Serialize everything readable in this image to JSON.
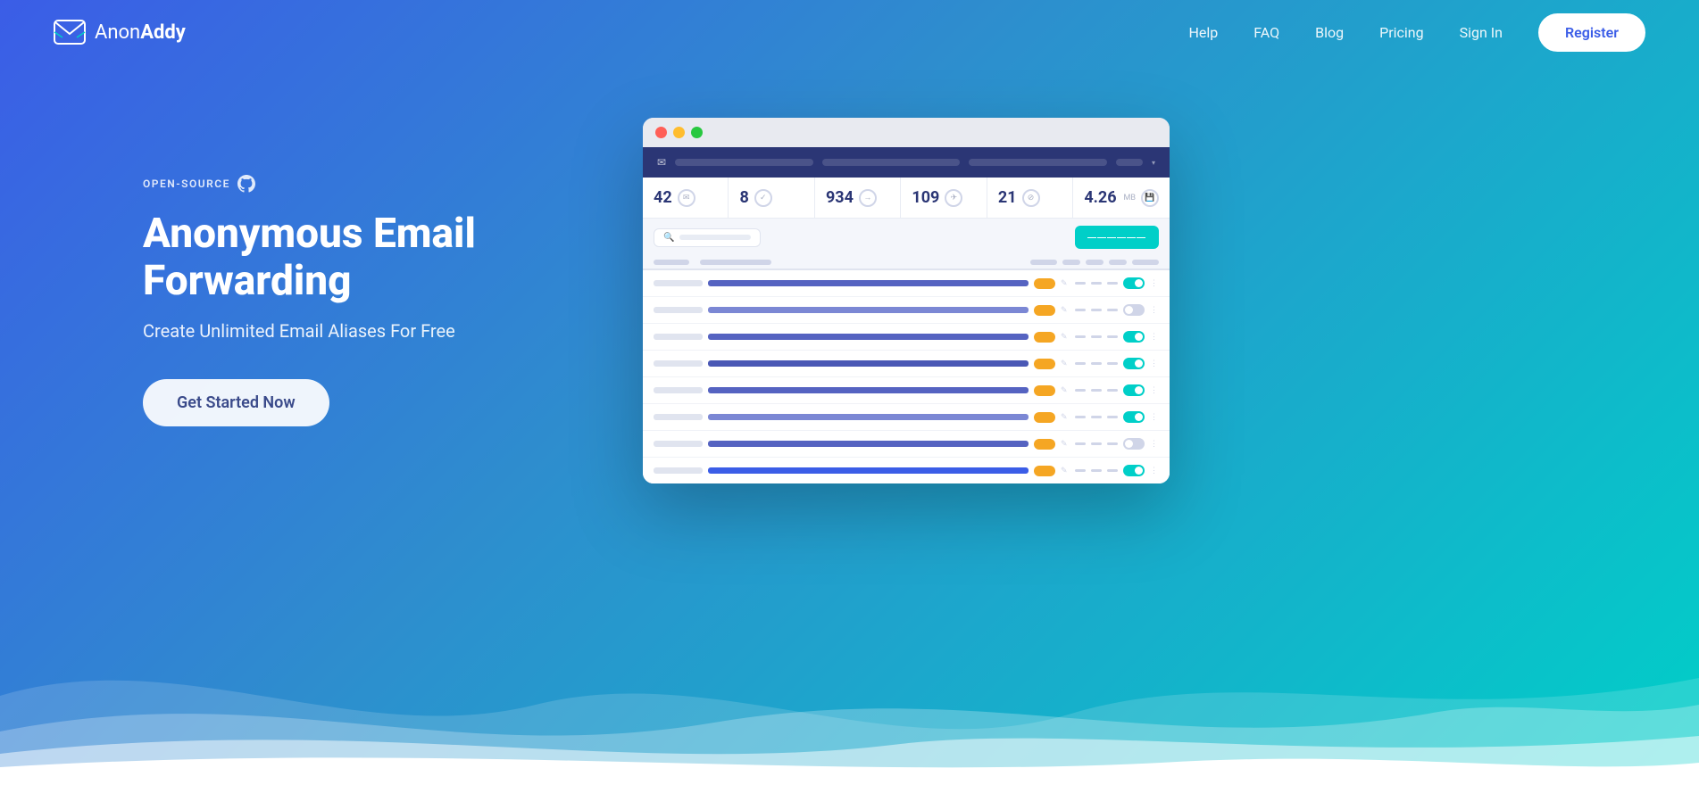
{
  "brand": {
    "name_prefix": "Anon",
    "name_suffix": "Addy"
  },
  "nav": {
    "links": [
      {
        "label": "Help",
        "id": "help"
      },
      {
        "label": "FAQ",
        "id": "faq"
      },
      {
        "label": "Blog",
        "id": "blog"
      },
      {
        "label": "Pricing",
        "id": "pricing"
      },
      {
        "label": "Sign In",
        "id": "signin"
      }
    ],
    "register_label": "Register"
  },
  "hero": {
    "badge": "OPEN-SOURCE",
    "title": "Anonymous Email Forwarding",
    "subtitle": "Create Unlimited Email Aliases For Free",
    "cta": "Get Started Now"
  },
  "dashboard": {
    "stats": [
      {
        "num": "42",
        "icon": "✉"
      },
      {
        "num": "8",
        "icon": "✓"
      },
      {
        "num": "934",
        "icon": "→"
      },
      {
        "num": "109",
        "icon": "✈"
      },
      {
        "num": "21",
        "icon": "⊘"
      },
      {
        "num": "4.26",
        "suffix": "MB",
        "icon": "💾"
      }
    ],
    "new_alias_btn": "——————",
    "rows": [
      {
        "alias_width": "75%",
        "toggle": "on"
      },
      {
        "alias_width": "55%",
        "toggle": "off"
      },
      {
        "alias_width": "68%",
        "toggle": "on"
      },
      {
        "alias_width": "50%",
        "toggle": "on"
      },
      {
        "alias_width": "70%",
        "toggle": "on"
      },
      {
        "alias_width": "48%",
        "toggle": "on"
      },
      {
        "alias_width": "62%",
        "toggle": "off"
      },
      {
        "alias_width": "55%",
        "toggle": "on"
      }
    ]
  },
  "colors": {
    "accent": "#00cfc8",
    "primary": "#3b5de7",
    "dark": "#2b3675",
    "tag": "#f5a623"
  }
}
